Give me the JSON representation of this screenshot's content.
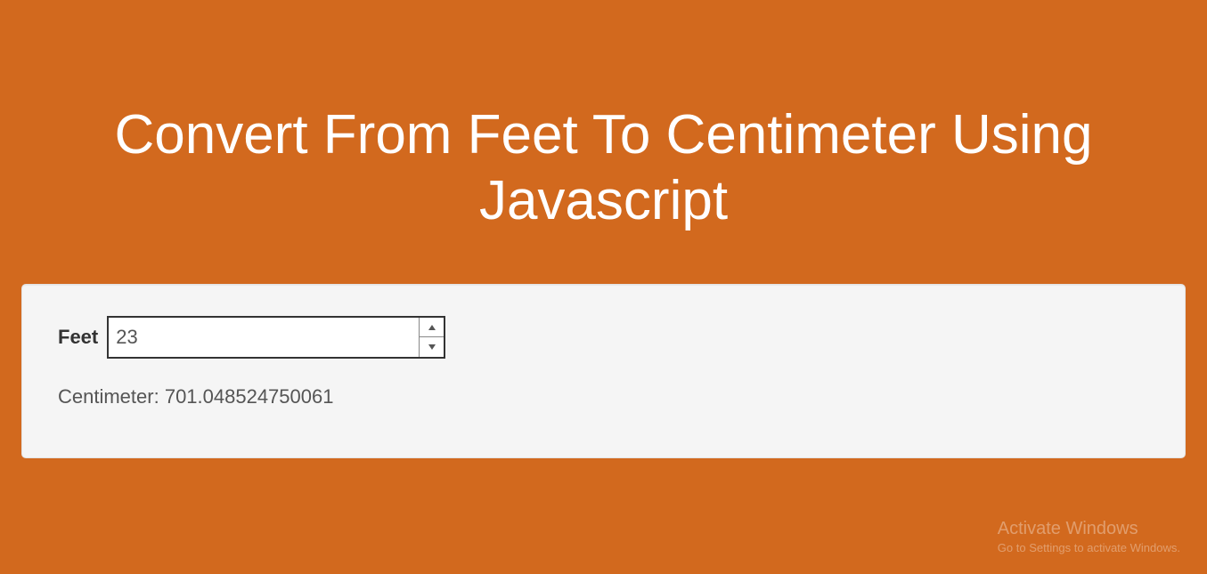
{
  "header": {
    "title": "Convert From Feet To Centimeter Using Javascript"
  },
  "form": {
    "feet_label": "Feet",
    "feet_value": "23",
    "result_label_prefix": "Centimeter: ",
    "result_value": "701.048524750061"
  },
  "watermark": {
    "title": "Activate Windows",
    "subtitle": "Go to Settings to activate Windows."
  }
}
